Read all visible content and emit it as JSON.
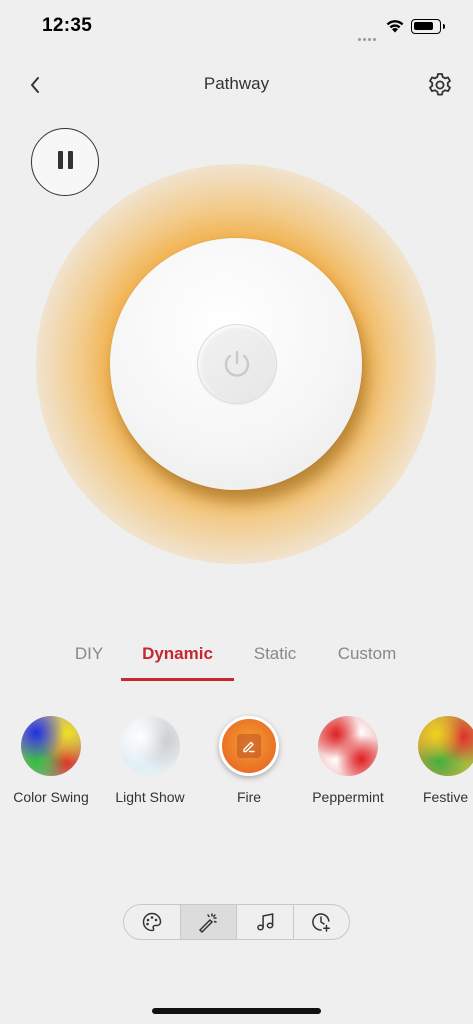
{
  "status_bar": {
    "time": "12:35"
  },
  "nav": {
    "title": "Pathway"
  },
  "icons": {
    "back": "chevron-left-icon",
    "settings": "gear-icon",
    "pause": "pause-icon",
    "power": "power-icon",
    "edit": "pencil-icon",
    "palette": "palette-icon",
    "magic_wand": "magic-wand-icon",
    "music": "music-note-icon",
    "timer": "clock-add-icon"
  },
  "colors": {
    "accent": "#c5282e",
    "glow": "#f0961a",
    "background": "#efefef"
  },
  "tabs": [
    {
      "label": "DIY",
      "active": false
    },
    {
      "label": "Dynamic",
      "active": true
    },
    {
      "label": "Static",
      "active": false
    },
    {
      "label": "Custom",
      "active": false
    }
  ],
  "effects": [
    {
      "label": "Color Swing"
    },
    {
      "label": "Light Show"
    },
    {
      "label": "Fire",
      "selected": true
    },
    {
      "label": "Peppermint"
    },
    {
      "label": "Festive"
    }
  ],
  "mode_bar": {
    "active_index": 1
  }
}
